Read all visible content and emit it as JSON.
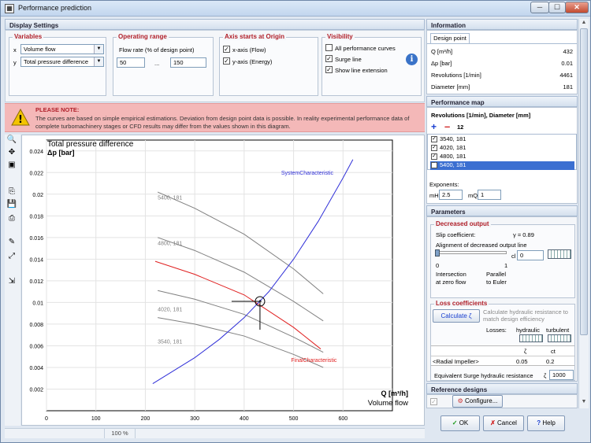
{
  "window": {
    "title": "Performance prediction",
    "min": "─",
    "max": "☐",
    "close": "✕"
  },
  "display_settings": {
    "title": "Display Settings"
  },
  "variables": {
    "title": "Variables",
    "x_label": "x",
    "x_value": "Volume flow",
    "y_label": "y",
    "y_value": "Total pressure difference"
  },
  "operating_range": {
    "title": "Operating range",
    "flow_label": "Flow rate (% of design point)",
    "from": "50",
    "sep": "...",
    "to": "150"
  },
  "axis_origin": {
    "title": "Axis starts at Origin",
    "x_axis": "x-axis (Flow)",
    "y_axis": "y-axis (Energy)"
  },
  "visibility": {
    "title": "Visibility",
    "all_curves": "All performance curves",
    "surge_line": "Surge line",
    "show_ext": "Show line extension"
  },
  "note": {
    "title": "PLEASE NOTE:",
    "text": "The curves are based on simple empirical estimations. Deviation from design point data is possible. In reality experimental performance data of complete turbomachinery stages or CFD results may differ from the values shown in this diagram."
  },
  "status": {
    "zoom": "100 %"
  },
  "information": {
    "title": "Information",
    "tab": "Design point",
    "rows": [
      {
        "label": "Q [m³/h]",
        "value": "432"
      },
      {
        "label": "Δp [bar]",
        "value": "0.01"
      },
      {
        "label": "Revolutions [1/min]",
        "value": "4461"
      },
      {
        "label": "Diameter [mm]",
        "value": "181"
      }
    ]
  },
  "performance_map": {
    "title": "Performance map",
    "subtitle": "Revolutions [1/min], Diameter [mm]",
    "add": "+",
    "remove": "–",
    "sort": "12",
    "items": [
      "3540, 181",
      "4020, 181",
      "4800, 181",
      "5400, 181"
    ],
    "exponents_label": "Exponents:",
    "mh_label": "mH",
    "mh_value": "2.5",
    "mq_label": "mQ",
    "mq_value": "1"
  },
  "parameters": {
    "title": "Parameters",
    "decreased_output": "Decreased output",
    "slip_label": "Slip coefficient:",
    "slip_value": "γ = 0.89",
    "alignment_label": "Alignment of decreased output line",
    "cl_label": "cl",
    "cl_value": "0",
    "tick0": "0",
    "tick1": "1",
    "left_note": "Intersection\nat zero flow",
    "right_note": "Parallel\nto Euler",
    "loss_title": "Loss coefficients",
    "calc_btn": "Calculate ζ",
    "calc_note": "Calculate hydraulic resistance to match design efficiency",
    "losses_label": "Losses:",
    "hydraulic": "hydraulic",
    "turbulent": "turbulent",
    "zeta": "ζ",
    "ct": "ct",
    "impeller": "<Radial Impeller>",
    "impeller_h": "0.05",
    "impeller_t": "0.2",
    "surge_label": "Equivalent Surge hydraulic resistance",
    "surge_sym": "ζ",
    "surge_value": "1000"
  },
  "reference": {
    "title": "Reference designs",
    "configure": "Configure..."
  },
  "buttons": {
    "ok": "OK",
    "cancel": "Cancel",
    "help": "Help"
  },
  "chart_data": {
    "type": "line",
    "ylabel_top": "Total pressure difference",
    "ylabel_unit": "Δp [bar]",
    "xlabel_top": "Q [m³/h]",
    "xlabel_bottom": "Volume flow",
    "xlim": [
      0,
      700
    ],
    "ylim": [
      0,
      0.025
    ],
    "xticks": [
      0,
      100,
      200,
      300,
      400,
      500,
      600
    ],
    "yticks": [
      0.002,
      0.004,
      0.006,
      0.008,
      0.01,
      0.012,
      0.014,
      0.016,
      0.018,
      0.02,
      0.022,
      0.024
    ],
    "series": [
      {
        "name": "5400, 181",
        "color": "#808080",
        "label_x": 225,
        "label_y": 0.0195,
        "points": [
          [
            225,
            0.0202
          ],
          [
            300,
            0.0187
          ],
          [
            400,
            0.0163
          ],
          [
            500,
            0.0131
          ],
          [
            560,
            0.0108
          ]
        ]
      },
      {
        "name": "4800, 181",
        "color": "#808080",
        "label_x": 225,
        "label_y": 0.0153,
        "points": [
          [
            225,
            0.016
          ],
          [
            300,
            0.0148
          ],
          [
            400,
            0.0128
          ],
          [
            500,
            0.0101
          ],
          [
            560,
            0.0083
          ]
        ]
      },
      {
        "name": "4020, 181",
        "color": "#808080",
        "label_x": 225,
        "label_y": 0.0092,
        "points": [
          [
            225,
            0.0111
          ],
          [
            300,
            0.0103
          ],
          [
            400,
            0.0089
          ],
          [
            500,
            0.0068
          ],
          [
            560,
            0.0054
          ]
        ]
      },
      {
        "name": "3540, 181",
        "color": "#808080",
        "label_x": 225,
        "label_y": 0.0062,
        "points": [
          [
            225,
            0.0086
          ],
          [
            300,
            0.008
          ],
          [
            400,
            0.0069
          ],
          [
            500,
            0.0052
          ],
          [
            560,
            0.004
          ]
        ]
      },
      {
        "name": "FinalCharacteristic",
        "color": "#e02020",
        "label_x": 495,
        "label_y": 0.0045,
        "points": [
          [
            220,
            0.0138
          ],
          [
            300,
            0.0126
          ],
          [
            400,
            0.0107
          ],
          [
            500,
            0.0077
          ],
          [
            555,
            0.0057
          ]
        ]
      },
      {
        "name": "SystemCharacteristic",
        "color": "#3030d8",
        "label_x": 475,
        "label_y": 0.0218,
        "points": [
          [
            215,
            0.0025
          ],
          [
            300,
            0.0049
          ],
          [
            350,
            0.0066
          ],
          [
            400,
            0.0086
          ],
          [
            450,
            0.011
          ],
          [
            500,
            0.014
          ],
          [
            550,
            0.0175
          ],
          [
            600,
            0.0215
          ],
          [
            620,
            0.0232
          ]
        ]
      }
    ],
    "design_point": {
      "x": 432,
      "y": 0.0101
    }
  }
}
